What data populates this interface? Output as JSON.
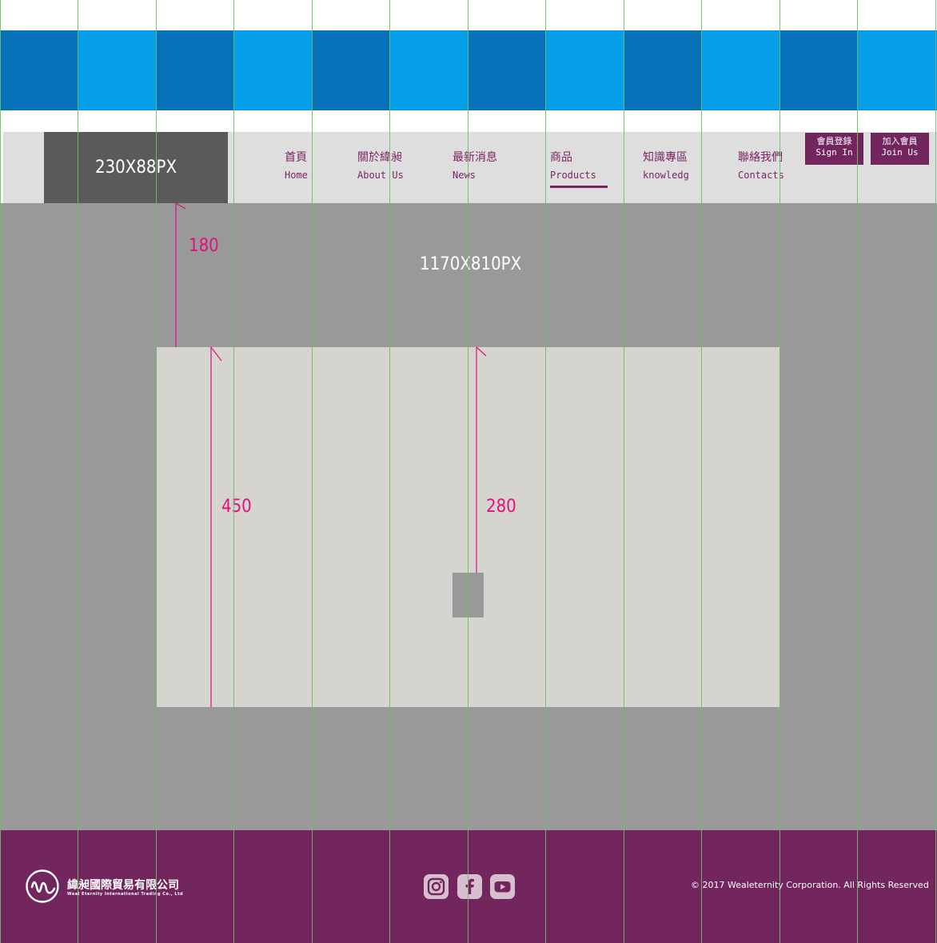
{
  "colors": {
    "stripe_dark": "#0670b8",
    "stripe_light": "#049fe8",
    "header_bg": "#dedede",
    "logo_placeholder": "#5a5a5a",
    "main_bg": "#999999",
    "inner_bg": "#d5d4cf",
    "brand_purple": "#73255e",
    "nav_text": "#7a2562",
    "measure_magenta": "#e0117f",
    "grid_green": "#6bbf6b"
  },
  "logo_placeholder_label": "230X88PX",
  "nav": {
    "items": [
      {
        "zh": "首頁",
        "en": "Home"
      },
      {
        "zh": "關於緯昶",
        "en": "About Us"
      },
      {
        "zh": "最新消息",
        "en": "News"
      },
      {
        "zh": "商品",
        "en": "Products"
      },
      {
        "zh": "知識專區",
        "en": "knowledg"
      },
      {
        "zh": "聯絡我們",
        "en": "Contacts"
      }
    ],
    "active_index": 3
  },
  "member": {
    "sign_in": {
      "zh": "會員登錄",
      "en": "Sign In"
    },
    "join": {
      "zh": "加入會員",
      "en": "Join Us"
    }
  },
  "main": {
    "dimension_label": "1170X810PX"
  },
  "measurements": {
    "top_offset": "180",
    "inner_height": "450",
    "item_offset": "280"
  },
  "footer": {
    "company_name": "緯昶國際貿易有限公司",
    "company_name_en": "Weal Eternity International Trading Co., Ltd",
    "social_icons": [
      "instagram-icon",
      "facebook-icon",
      "youtube-icon"
    ],
    "copyright": "© 2017 Wealeternity Corporation. All Rights Reserved"
  }
}
